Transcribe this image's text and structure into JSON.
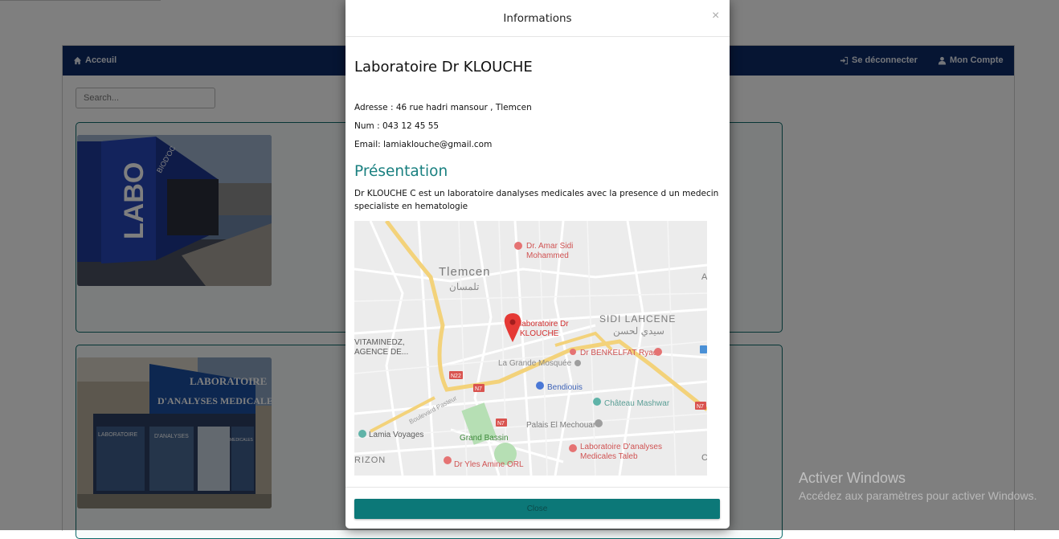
{
  "navbar": {
    "home_label": "Acceuil",
    "logout_label": "Se déconnecter",
    "account_label": "Mon Compte",
    "color": "#0d2a66"
  },
  "search": {
    "placeholder": "Search..."
  },
  "cards": [
    {
      "image_sign": "LABO",
      "image_brand": "BIOD'OC"
    },
    {
      "image_sign_line1": "LABORATOIRE",
      "image_sign_line2": "D'ANALYSES MEDICALES",
      "window_text_1": "LABORATOIRE",
      "window_text_2": "D'ANALYSES",
      "window_text_3": "MEDICALES"
    }
  ],
  "modal": {
    "title": "Informations",
    "close_icon": "×",
    "lab_name": "Laboratoire Dr KLOUCHE",
    "address": "Adresse : 46 rue hadri mansour , Tlemcen",
    "number": "Num : 043 12 45 55",
    "email": "Email: lamiaklouche@gmail.com",
    "presentation_title": "Présentation",
    "presentation_text": "Dr KLOUCHE C est un laboratoire danalyses medicales avec la presence d un medecin specialiste en hematologie",
    "close_button": "Close",
    "accent_color": "#0c7878"
  },
  "map": {
    "city": "Tlemcen",
    "city_ar": "تلمسان",
    "district": "SIDI LAHCENE",
    "district_ar": "سيدي لحسن",
    "marker_line1": "laboratoire Dr",
    "marker_line2": "KLOUCHE",
    "poi_amar_line1": "Dr. Amar Sidi",
    "poi_amar_line2": "Mohammed",
    "poi_benkelfat": "Dr BENKELFAT Ryad",
    "poi_mosquee": "La Grande Mosquée",
    "poi_bendiouis": "Bendiouis",
    "poi_chateau": "Château Mashwar",
    "poi_mechouar": "Palais El Mechouar",
    "poi_taleb_line1": "Laboratoire D'analyses",
    "poi_taleb_line2": "Medicales Taleb",
    "poi_lamia": "Lamia Voyages",
    "poi_grand_bassin": "Grand Bassin",
    "poi_yles": "Dr Yles Amine ORL",
    "poi_vitamine_line1": "VITAMINEDZ,",
    "poi_vitamine_line2": "AGENCE DE...",
    "poi_rizon": "RIZON",
    "street_pasteur": "Boulevard Pasteur",
    "road_n22": "N22",
    "road_n7a": "N7",
    "road_n7b": "N7",
    "road_n7c": "N7",
    "edge_a": "A",
    "edge_c": "C"
  },
  "windows_watermark": {
    "title": "Activer Windows",
    "subtitle": "Accédez aux paramètres pour activer Windows."
  }
}
